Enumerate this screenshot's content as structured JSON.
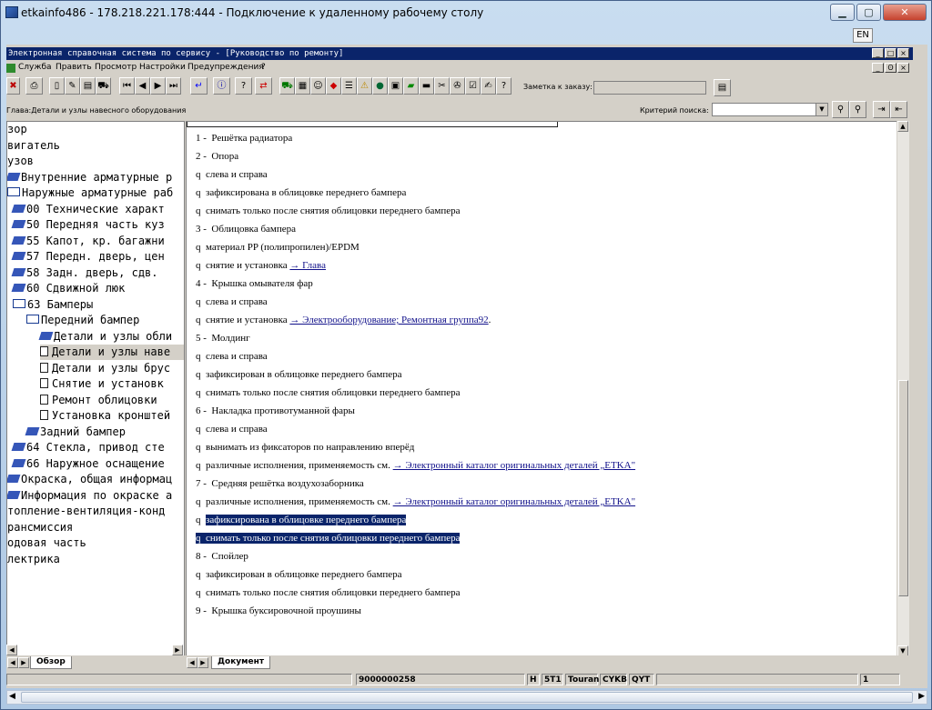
{
  "rdp": {
    "title": "etkainfo486 - 178.218.221.178:444 - Подключение к удаленному рабочему столу",
    "lang": "EN"
  },
  "app": {
    "title": "Электронная справочная система по сервису - [Руководство по ремонту]"
  },
  "menu": [
    "Служба",
    "Править",
    "Просмотр",
    "Настройки",
    "Предупреждения",
    "?"
  ],
  "toolbar": {
    "note_label": "Заметка к заказу:"
  },
  "chapter_label": "Глава:Детали и узлы навесного оборудования",
  "search": {
    "label": "Критерий поиска:",
    "value": ""
  },
  "tree": [
    "зор",
    "вигатель",
    "узов",
    "Внутренние арматурные р",
    "Наружные арматурные раб",
    "00 Технические характ",
    "50 Передняя часть куз",
    "55 Капот, кр. багажни",
    "57 Передн. дверь, цен",
    "58 Задн. дверь, сдв.",
    "60 Сдвижной люк",
    "63 Бамперы",
    "Передний бампер",
    "Детали и узлы обли",
    "Детали и узлы наве",
    "Детали и узлы брус",
    "Снятие и установк",
    "Ремонт облицовки",
    "Установка кронштей",
    "Задний бампер",
    "64 Стекла, привод сте",
    "66 Наружное оснащение",
    "Окраска, общая информац",
    "Информация по окраске а",
    "топление-вентиляция-конд",
    "рансмиссия",
    "одовая часть",
    "лектрика"
  ],
  "doc": [
    {
      "m": "1 -",
      "t": "Решётка радиатора"
    },
    {
      "m": "2 -",
      "t": "Опора"
    },
    {
      "m": "q",
      "t": "слева и справа"
    },
    {
      "m": "q",
      "t": "зафиксирована в облицовке переднего бампера"
    },
    {
      "m": "q",
      "t": "снимать только после снятия облицовки переднего бампера"
    },
    {
      "m": "3 -",
      "t": "Облицовка бампера"
    },
    {
      "m": "q",
      "t": "материал PP (полипропилен)/EPDM"
    },
    {
      "m": "q",
      "t": "снятие и установка",
      "link": "→ Глава"
    },
    {
      "m": "4 -",
      "t": "Крышка омывателя фар"
    },
    {
      "m": "q",
      "t": "слева и справа"
    },
    {
      "m": "q",
      "t": "снятие и установка",
      "link": "→ Электрооборудование; Ремонтная группа92",
      "tail": "."
    },
    {
      "m": "5 -",
      "t": "Молдинг"
    },
    {
      "m": "q",
      "t": "слева и справа"
    },
    {
      "m": "q",
      "t": "зафиксирован в облицовке переднего бампера"
    },
    {
      "m": "q",
      "t": "снимать только после снятия облицовки переднего бампера"
    },
    {
      "m": "6 -",
      "t": "Накладка противотуманной фары"
    },
    {
      "m": "q",
      "t": "слева и справа"
    },
    {
      "m": "q",
      "t": "вынимать из фиксаторов по направлению вперёд"
    },
    {
      "m": "q",
      "t": "различные исполнения, применяемость см.",
      "link": "→ Электронный каталог оригинальных деталей „ETKA\""
    },
    {
      "m": "7 -",
      "t": "Средняя решётка воздухозаборника"
    },
    {
      "m": "q",
      "t": "различные исполнения, применяемость см.",
      "link": "→ Электронный каталог оригинальных деталей „ETKA\""
    },
    {
      "m": "q",
      "t": "зафиксирована в облицовке переднего бампера"
    },
    {
      "m": "q",
      "t": "снимать только после снятия облицовки переднего бампера"
    },
    {
      "m": "8 -",
      "t": "Спойлер"
    },
    {
      "m": "q",
      "t": "зафиксирован в облицовке переднего бампера"
    },
    {
      "m": "q",
      "t": "снимать только после снятия облицовки переднего бампера"
    },
    {
      "m": "9 -",
      "t": "Крышка буксировочной проушины"
    }
  ],
  "tabs": {
    "left": "Обзор",
    "right": "Документ"
  },
  "status": {
    "order": "9000000258",
    "code1": "H",
    "code2": "5T1",
    "model": "Touran",
    "engine": "CYKB",
    "gear": "QYT",
    "page": "1"
  }
}
